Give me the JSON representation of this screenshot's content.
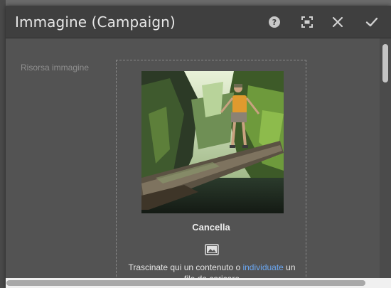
{
  "dialog": {
    "title": "Immagine (Campaign)",
    "actions": [
      {
        "name": "help-icon",
        "label": "?"
      },
      {
        "name": "fullscreen-icon",
        "label": "fullscreen"
      },
      {
        "name": "close-icon",
        "label": "close"
      },
      {
        "name": "confirm-icon",
        "label": "done"
      }
    ]
  },
  "field": {
    "label": "Risorsa immagine",
    "clear_label": "Cancella",
    "drop_text_before": "Trascinate qui un contenuto o ",
    "drop_link": "individuate",
    "drop_text_after": " un file da caricare"
  },
  "colors": {
    "header_bg": "#3f3f3f",
    "body_bg": "#535353",
    "link": "#6aa6f0"
  }
}
